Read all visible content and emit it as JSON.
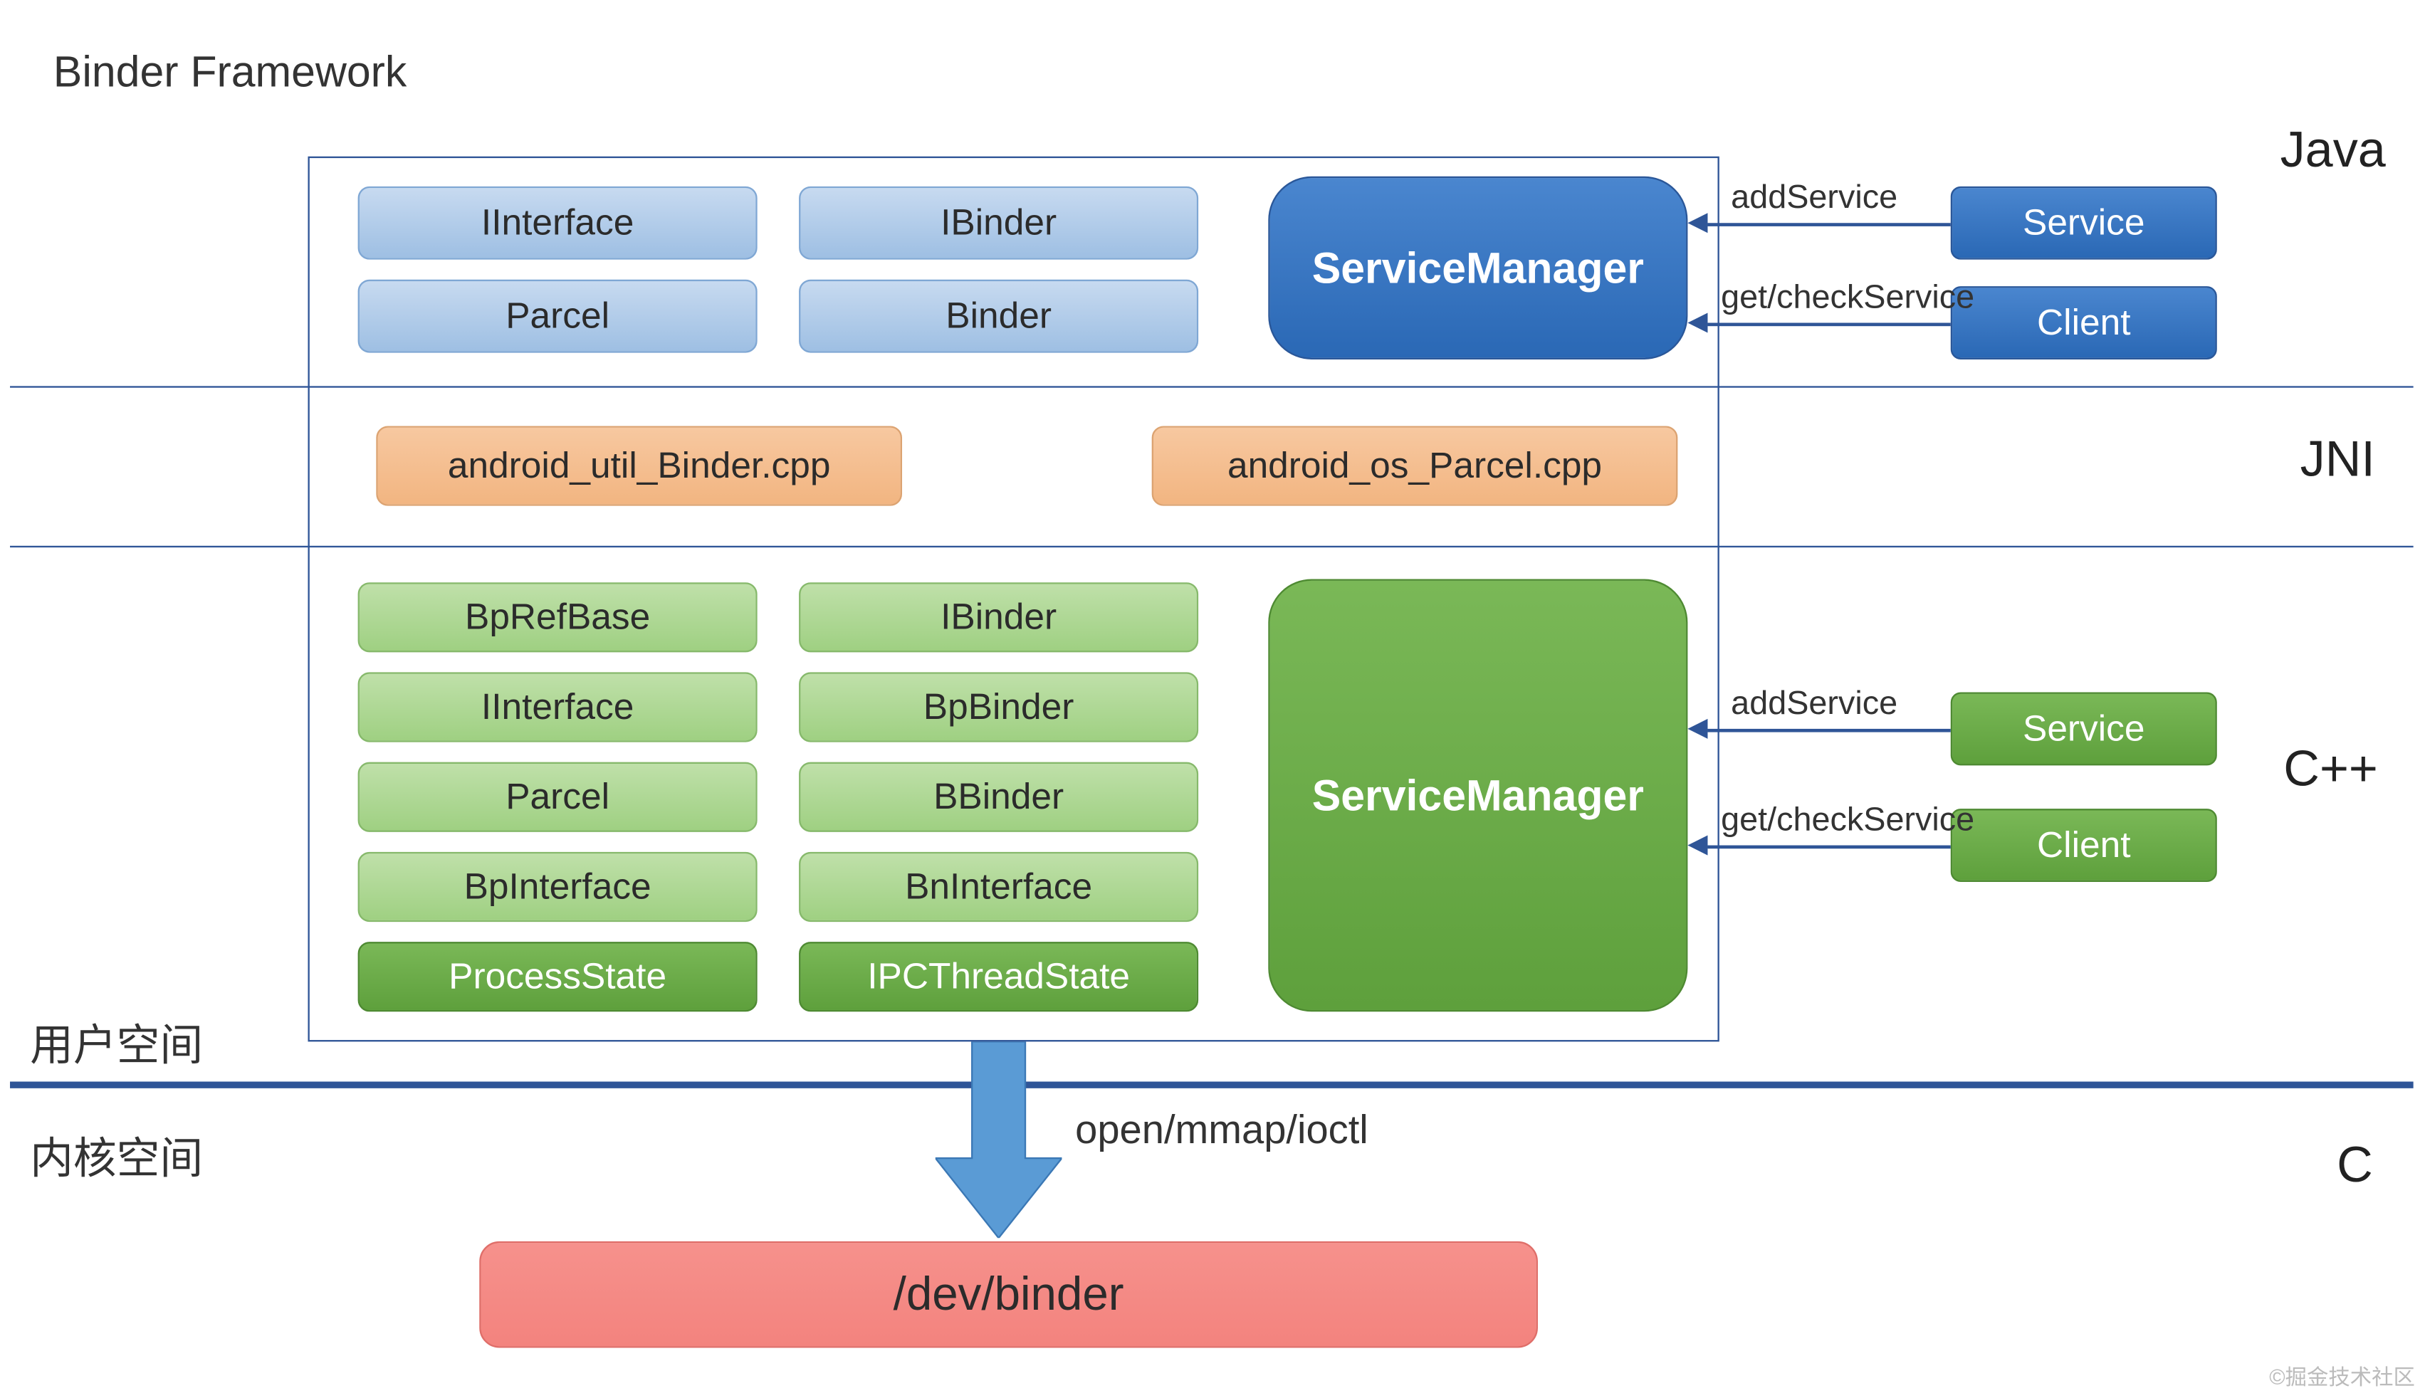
{
  "title": "Binder Framework",
  "layers": {
    "java": {
      "label": "Java"
    },
    "jni": {
      "label": "JNI"
    },
    "cpp": {
      "label": "C++"
    },
    "c": {
      "label": "C"
    }
  },
  "space": {
    "user": "用户空间",
    "kernel": "内核空间"
  },
  "java_row": {
    "col1": [
      "IInterface",
      "Parcel"
    ],
    "col2": [
      "IBinder",
      "Binder"
    ],
    "service_manager": "ServiceManager"
  },
  "jni_row": {
    "left": "android_util_Binder.cpp",
    "right": "android_os_Parcel.cpp"
  },
  "cpp_row": {
    "col1": [
      "BpRefBase",
      "IInterface",
      "Parcel",
      "BpInterface",
      "ProcessState"
    ],
    "col2": [
      "IBinder",
      "BpBinder",
      "BBinder",
      "BnInterface",
      "IPCThreadState"
    ],
    "service_manager": "ServiceManager"
  },
  "ext_java": {
    "add": "addService",
    "get": "get/checkService",
    "service": "Service",
    "client": "Client"
  },
  "ext_cpp": {
    "add": "addService",
    "get": "get/checkService",
    "service": "Service",
    "client": "Client"
  },
  "kernel": {
    "ops": "open/mmap/ioctl",
    "dev": "/dev/binder"
  },
  "watermark": "©掘金技术社区"
}
